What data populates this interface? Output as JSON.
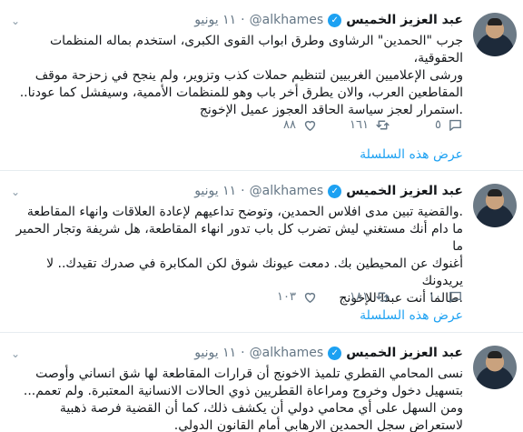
{
  "tweets": [
    {
      "name": "عبد العزيز الخميس",
      "handle": "@alkhames",
      "separator": "·",
      "date": "١١ يونيو",
      "text": "جرب \"الحمدين\" الرشاوى وطرق ابواب القوى الكبرى، استخدم بماله المنظمات الحقوقية،\nورشى الإعلاميين الغربيين لتنظيم حملات كذب وتزوير، ولم ينجح في زحزحة موقف\nالمقاطعين العرب، والان يطرق أخر باب وهو للمنظمات الأممية، وسيفشل كما عودنا..\n.استمرار لعجز سياسة الحاقد العجوز عميل الإخونج",
      "replies": "٥",
      "retweets": "١٦١",
      "likes": "٨٨",
      "thread_link": "عرض هذه السلسلة"
    },
    {
      "name": "عبد العزيز الخميس",
      "handle": "@alkhames",
      "separator": "·",
      "date": "١١ يونيو",
      "text": ".والقضية تبين مدى افلاس الحمدين، وتوضح تداعيهم لإعادة العلاقات وانهاء المقاطعة\nما دام أنك مستغني ليش تضرب كل باب تدور انهاء المقاطعة، هل شريفة وتجار الحمير ما\nأغنوك عن المحيطين بك. دمعت عيونك شوق لكن المكابرة في صدرك تقيدك.. لا يريدونك\n.طالما أنت عبدا للإخونج",
      "replies": "١٠",
      "retweets": "١٨١",
      "likes": "١٠٣",
      "thread_link": "عرض هذه السلسلة"
    },
    {
      "name": "عبد العزيز الخميس",
      "handle": "@alkhames",
      "separator": "·",
      "date": "١١ يونيو",
      "text": "نسى المحامي القطري تلميذ الاخونج أن قرارات المقاطعة لها شق انساني وأوصت\nبتسهيل دخول وخروج ومراعاة القطريين ذوي الحالات الانسانية المعتبرة. ولم تعمم...\nومن السهل على أي محامي دولي أن يكشف ذلك، كما أن القضية فرصة ذهبية\nلاستعراض سجل الحمدين الارهابي أمام القانون الدولي."
    }
  ],
  "colors": {
    "accent": "#1da1f2",
    "muted": "#657786"
  }
}
